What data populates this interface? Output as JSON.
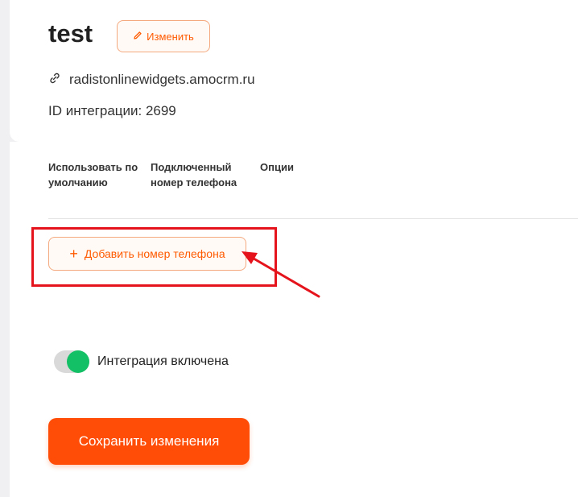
{
  "integration": {
    "name": "test",
    "edit_label": "Изменить",
    "domain": "radistonlinewidgets.amocrm.ru",
    "id_label": "ID интеграции: 2699"
  },
  "table": {
    "columns": [
      "Использовать по умолчанию",
      "Подключенный номер телефона",
      "Опции"
    ]
  },
  "actions": {
    "add_phone_label": "Добавить номер телефона",
    "save_label": "Сохранить изменения"
  },
  "toggle": {
    "label": "Интеграция включена",
    "enabled": true
  },
  "icons": {
    "edit": "pencil-icon",
    "domain": "link-icon",
    "add": "plus-icon"
  },
  "colors": {
    "accent": "#ff5a00",
    "primary_button": "#ff4d07",
    "toggle_on": "#13c065",
    "annotation": "#e5141c"
  }
}
